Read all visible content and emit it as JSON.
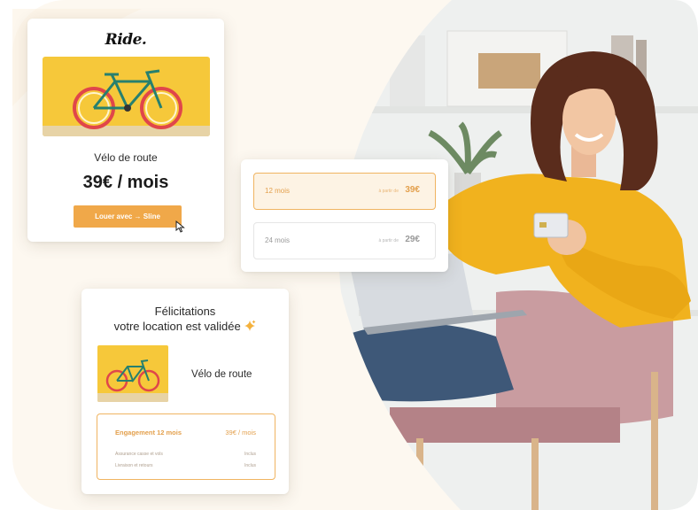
{
  "product_card": {
    "brand": "Ride.",
    "product_name": "Vélo de route",
    "price": "39€ / mois",
    "rent_button": "Louer avec → Sline"
  },
  "plans_card": {
    "plans": [
      {
        "label": "12 mois",
        "from": "à partir de",
        "price": "39€",
        "selected": true
      },
      {
        "label": "24 mois",
        "from": "à partir de",
        "price": "29€",
        "selected": false
      }
    ]
  },
  "confirmation_card": {
    "title_line1": "Félicitations",
    "title_line2": "votre location est validée",
    "product_name": "Vélo de route",
    "summary": {
      "head_label": "Engagement 12 mois",
      "head_value": "39€ / mois",
      "rows": [
        {
          "label": "Assurance casse et vols",
          "value": "Inclus"
        },
        {
          "label": "Livraison et retours",
          "value": "Inclus"
        }
      ]
    }
  },
  "colors": {
    "accent": "#f0a849",
    "accent_text": "#e3a04d",
    "selected_bg": "#fdf3e4",
    "background": "#fdf8f0",
    "bike_backdrop": "#f6c83a",
    "sweater": "#f1b21e"
  },
  "icons": [
    "cursor-pointer-icon",
    "sparkle-icon",
    "bicycle-image"
  ]
}
